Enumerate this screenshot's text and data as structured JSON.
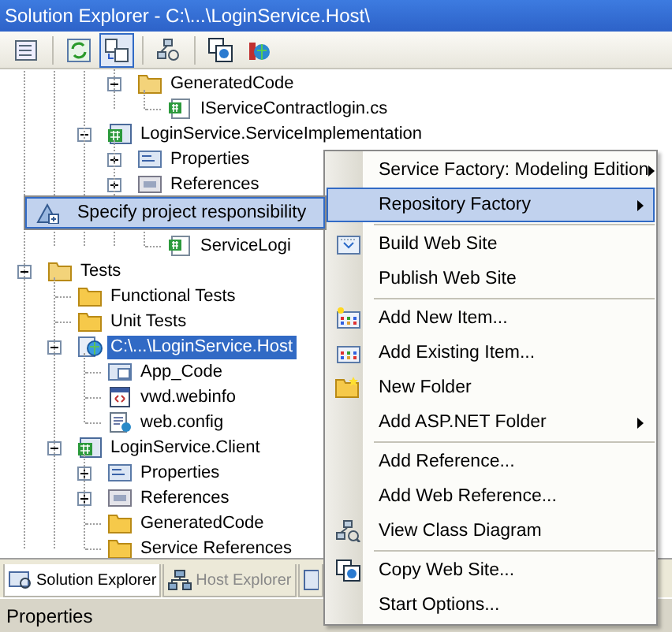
{
  "window": {
    "title": "Solution Explorer - C:\\...\\LoginService.Host\\"
  },
  "toolbar": [
    {
      "kind": "properties",
      "pressed": false
    },
    {
      "kind": "refresh",
      "pressed": false
    },
    {
      "kind": "nest",
      "pressed": true
    },
    {
      "kind": "class-diagram",
      "pressed": false
    },
    {
      "kind": "copy-web",
      "pressed": false
    },
    {
      "kind": "web-config",
      "pressed": false
    }
  ],
  "tree": [
    {
      "children": [
        {
          "children": [
            {
              "children": [
                {
                  "children": [
                    {
                      "label": "GeneratedCode",
                      "kind": "folder-open",
                      "expanded": true,
                      "selected": false,
                      "children": [
                        {
                          "label": "IServiceContractlogin.cs",
                          "kind": "cs-file",
                          "selected": false
                        }
                      ]
                    }
                  ]
                },
                {
                  "label": "LoginService.ServiceImplementation",
                  "kind": "cs-project",
                  "expanded": true,
                  "selected": false,
                  "children": [
                    {
                      "label": "Properties",
                      "kind": "properties",
                      "expanded": false,
                      "selected": false
                    },
                    {
                      "label": "References",
                      "kind": "references",
                      "expanded": false,
                      "selected": false
                    },
                    {
                      "children": [
                        {
                          "label": "ServiceLogi",
                          "kind": "cs-file",
                          "selected": false
                        }
                      ]
                    }
                  ]
                }
              ]
            }
          ]
        },
        {
          "label": "Tests",
          "kind": "folder-open",
          "expanded": true,
          "selected": false,
          "children": [
            {
              "label": "Functional Tests",
              "kind": "folder",
              "selected": false
            },
            {
              "label": "Unit Tests",
              "kind": "folder",
              "selected": false
            },
            {
              "label": "C:\\...\\LoginService.Host",
              "kind": "web-project",
              "expanded": true,
              "selected": true,
              "children": [
                {
                  "label": "App_Code",
                  "kind": "code-folder",
                  "selected": false
                },
                {
                  "label": "vwd.webinfo",
                  "kind": "webinfo",
                  "selected": false
                },
                {
                  "label": "web.config",
                  "kind": "config",
                  "selected": false
                }
              ]
            },
            {
              "label": "LoginService.Client",
              "kind": "cs-project",
              "expanded": true,
              "selected": false,
              "children": [
                {
                  "label": "Properties",
                  "kind": "properties",
                  "expanded": false,
                  "selected": false
                },
                {
                  "label": "References",
                  "kind": "references",
                  "expanded": false,
                  "selected": false
                },
                {
                  "label": "GeneratedCode",
                  "kind": "folder",
                  "selected": false
                },
                {
                  "label": "Service References",
                  "kind": "folder",
                  "selected": false
                }
              ]
            }
          ]
        }
      ]
    }
  ],
  "tabs": [
    {
      "label": "Solution Explorer",
      "kind": "solution",
      "selected": true
    },
    {
      "label": "Host Explorer",
      "kind": "host",
      "selected": false
    },
    {
      "kind": "other",
      "selected": false
    }
  ],
  "properties_bar": {
    "title": "Properties"
  },
  "context_menu": [
    {
      "kind": "submenu",
      "label": "Service Factory: Modeling Edition",
      "selected": false
    },
    {
      "kind": "submenu",
      "label": "Repository Factory",
      "selected": true
    },
    {
      "kind": "separator"
    },
    {
      "kind": "build",
      "label": "Build Web Site",
      "selected": false
    },
    {
      "kind": "plain",
      "label": "Publish Web Site",
      "selected": false
    },
    {
      "kind": "separator"
    },
    {
      "kind": "new-item",
      "label": "Add New Item...",
      "selected": false
    },
    {
      "kind": "existing-item",
      "label": "Add Existing Item...",
      "selected": false
    },
    {
      "kind": "new-folder",
      "label": "New Folder",
      "selected": false
    },
    {
      "kind": "submenu",
      "label": "Add ASP.NET Folder",
      "selected": false
    },
    {
      "kind": "separator"
    },
    {
      "kind": "plain",
      "label": "Add Reference...",
      "selected": false
    },
    {
      "kind": "plain",
      "label": "Add Web Reference...",
      "selected": false
    },
    {
      "kind": "class-diagram",
      "label": "View Class Diagram",
      "selected": false
    },
    {
      "kind": "separator"
    },
    {
      "kind": "copy-web",
      "label": "Copy Web Site...",
      "selected": false
    },
    {
      "kind": "plain",
      "label": "Start Options...",
      "selected": false
    }
  ],
  "submenu": [
    {
      "kind": "responsibility",
      "label": "Specify project responsibility",
      "selected": true
    }
  ]
}
